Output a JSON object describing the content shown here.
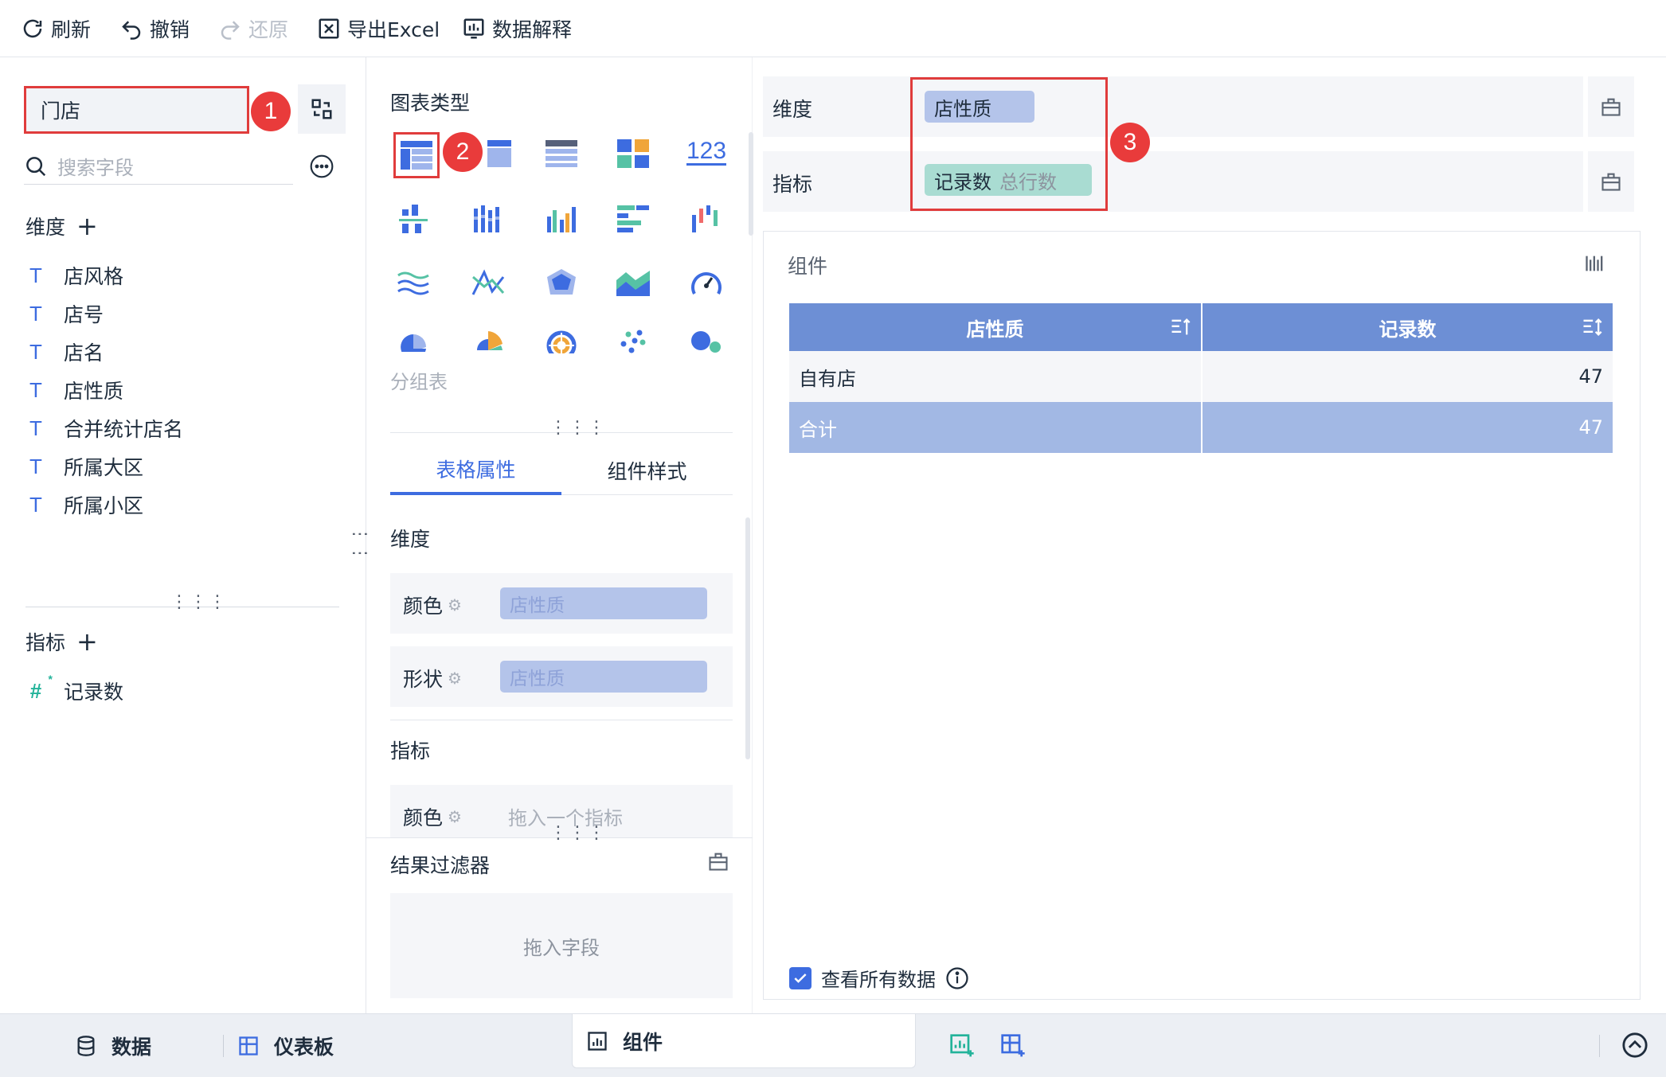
{
  "toolbar": {
    "refresh": "刷新",
    "undo": "撤销",
    "redo": "还原",
    "export_excel": "导出Excel",
    "data_explain": "数据解释"
  },
  "left": {
    "dataset": "门店",
    "badge1": "1",
    "search_placeholder": "搜索字段",
    "dimensions_title": "维度",
    "dimension_fields": [
      "店风格",
      "店号",
      "店名",
      "店性质",
      "合并统计店名",
      "所属大区",
      "所属小区"
    ],
    "measures_title": "指标",
    "measure_fields": [
      "记录数"
    ]
  },
  "middle": {
    "chart_type_title": "图表类型",
    "badge2": "2",
    "selected_chart_name": "分组表",
    "number_chart_label": "123",
    "tabs": [
      "表格属性",
      "组件样式"
    ],
    "dimension_section": "维度",
    "color_label": "颜色",
    "shape_label": "形状",
    "dimension_field": "店性质",
    "measure_section": "指标",
    "measure_placeholder": "拖入一个指标",
    "filter_title": "结果过滤器",
    "filter_placeholder": "拖入字段"
  },
  "right": {
    "dimension_label": "维度",
    "dimension_value": "店性质",
    "measure_label": "指标",
    "measure_value": "记录数",
    "measure_agg": "总行数",
    "badge3": "3",
    "component_title": "组件",
    "table": {
      "headers": [
        "店性质",
        "记录数"
      ],
      "rows": [
        [
          "自有店",
          "47"
        ]
      ],
      "total": [
        "合计",
        "47"
      ]
    },
    "view_all_data": "查看所有数据"
  },
  "bottom": {
    "data_tab": "数据",
    "dashboard_tab": "仪表板",
    "component_tab": "组件"
  },
  "colors": {
    "accent": "#3d6ce0",
    "badge_red": "#e93b3b",
    "dimension_pill": "#b4c4ea",
    "measure_pill": "#a9dcd2",
    "table_header": "#6d8fd5",
    "total_row": "#a2b8e4"
  }
}
